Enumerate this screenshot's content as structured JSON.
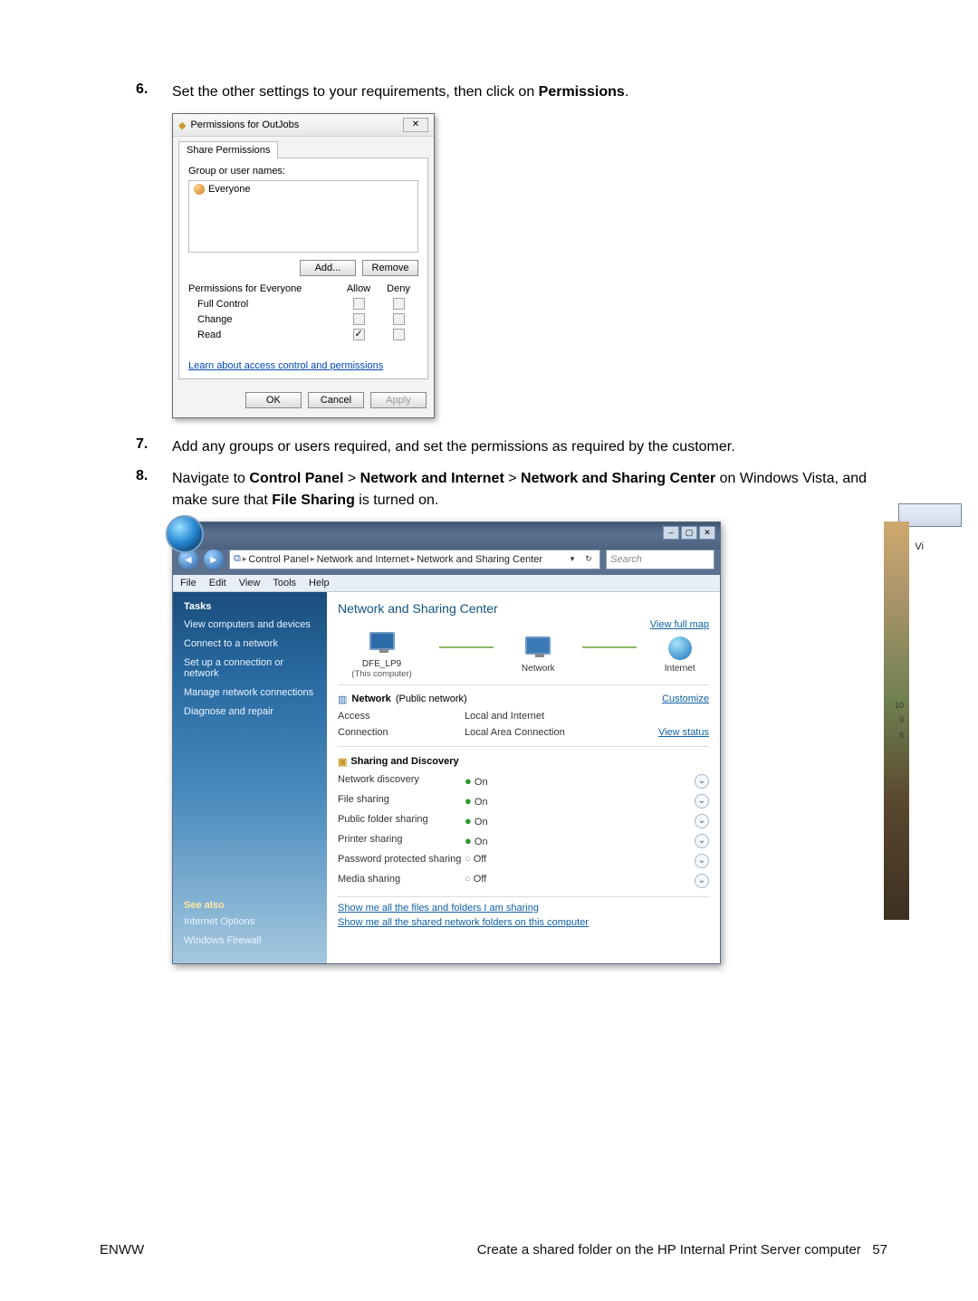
{
  "steps": {
    "s6": {
      "num": "6.",
      "text_a": "Set the other settings to your requirements, then click on ",
      "text_b": "Permissions",
      "text_c": "."
    },
    "s7": {
      "num": "7.",
      "text": "Add any groups or users required, and set the permissions as required by the customer."
    },
    "s8": {
      "num": "8.",
      "a": "Navigate to ",
      "b": "Control Panel",
      "c": " > ",
      "d": "Network and Internet",
      "e": " > ",
      "f": "Network and Sharing Center",
      "g": " on Windows Vista, and make sure that ",
      "h": "File Sharing",
      "i": " is turned on."
    }
  },
  "perm": {
    "title": "Permissions for OutJobs",
    "tab": "Share Permissions",
    "groups_label": "Group or user names:",
    "entry": "Everyone",
    "add": "Add...",
    "remove": "Remove",
    "for_label": "Permissions for Everyone",
    "col_allow": "Allow",
    "col_deny": "Deny",
    "rows": {
      "r1": "Full Control",
      "r2": "Change",
      "r3": "Read"
    },
    "learn": "Learn about access control and permissions",
    "ok": "OK",
    "cancel": "Cancel",
    "apply": "Apply"
  },
  "net": {
    "crumbs": {
      "c1": "Control Panel",
      "c2": "Network and Internet",
      "c3": "Network and Sharing Center"
    },
    "search_placeholder": "Search",
    "menu": {
      "m1": "File",
      "m2": "Edit",
      "m3": "View",
      "m4": "Tools",
      "m5": "Help"
    },
    "tasks_hdr": "Tasks",
    "tasks": {
      "t1": "View computers and devices",
      "t2": "Connect to a network",
      "t3": "Set up a connection or network",
      "t4": "Manage network connections",
      "t5": "Diagnose and repair"
    },
    "see_also_hdr": "See also",
    "see_also": {
      "a1": "Internet Options",
      "a2": "Windows Firewall"
    },
    "panel_title": "Network and Sharing Center",
    "view_full_map": "View full map",
    "nodes": {
      "n1": "DFE_LP9",
      "n1_sub": "(This computer)",
      "n2": "Network",
      "n3": "Internet"
    },
    "net_hdr": "Network",
    "net_hdr_paren": "(Public network)",
    "customize": "Customize",
    "access_lbl": "Access",
    "access_val": "Local and Internet",
    "conn_lbl": "Connection",
    "conn_val": "Local Area Connection",
    "view_status": "View status",
    "sd_hdr": "Sharing and Discovery",
    "rows": {
      "r1": {
        "lbl": "Network discovery",
        "val": "On",
        "on": true
      },
      "r2": {
        "lbl": "File sharing",
        "val": "On",
        "on": true
      },
      "r3": {
        "lbl": "Public folder sharing",
        "val": "On",
        "on": true
      },
      "r4": {
        "lbl": "Printer sharing",
        "val": "On",
        "on": true
      },
      "r5": {
        "lbl": "Password protected sharing",
        "val": "Off",
        "on": false
      },
      "r6": {
        "lbl": "Media sharing",
        "val": "Off",
        "on": false
      }
    },
    "bottom": {
      "b1": "Show me all the files and folders I am sharing",
      "b2": "Show me all the shared network folders on this computer"
    },
    "side_nums": {
      "n1": "10",
      "n2": "9",
      "n3": "8"
    },
    "vi": "Vi"
  },
  "footer": {
    "left": "ENWW",
    "right_text": "Create a shared folder on the HP Internal Print Server computer",
    "page": "57"
  }
}
